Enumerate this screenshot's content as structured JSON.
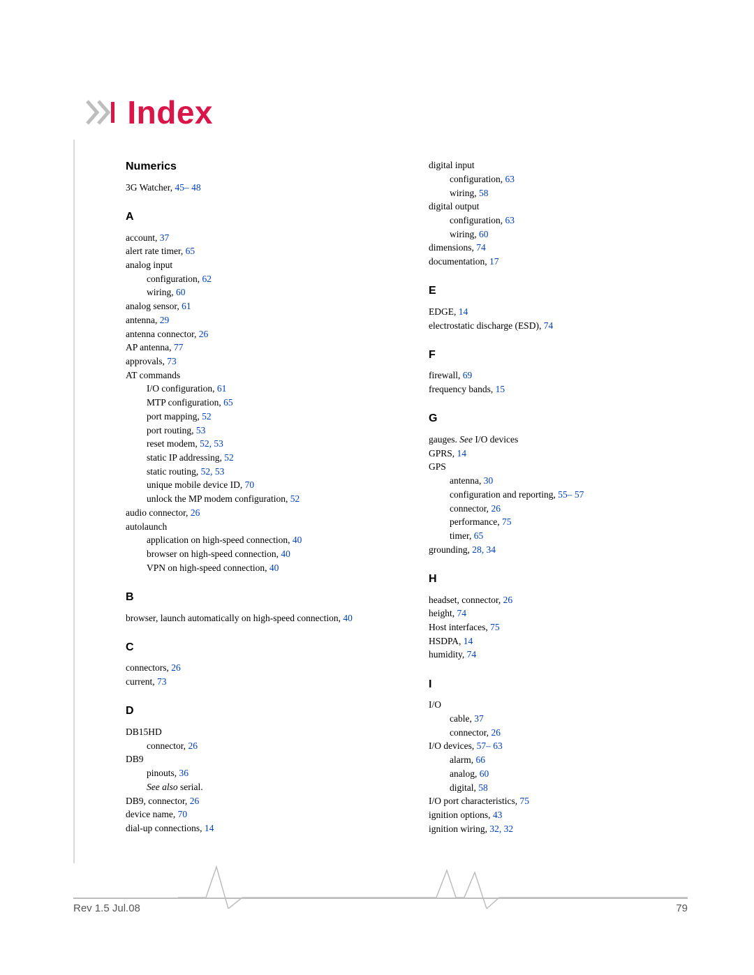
{
  "title": "Index",
  "footer": {
    "rev": "Rev 1.5  Jul.08",
    "page": "79"
  },
  "index": {
    "Numerics": {
      "ltr": "Numerics",
      "entries": [
        {
          "t": "3G Watcher,",
          "r": " 45– 48"
        }
      ]
    },
    "A": {
      "ltr": "A",
      "entries": [
        {
          "t": "account,",
          "r": " 37"
        },
        {
          "t": "alert rate timer,",
          "r": " 65"
        },
        {
          "t": "analog input"
        },
        {
          "t": "configuration,",
          "r": " 62",
          "lvl": 1
        },
        {
          "t": "wiring,",
          "r": " 60",
          "lvl": 1
        },
        {
          "t": "analog sensor,",
          "r": " 61"
        },
        {
          "t": "antenna,",
          "r": " 29"
        },
        {
          "t": "antenna connector,",
          "r": " 26"
        },
        {
          "t": "AP antenna,",
          "r": " 77"
        },
        {
          "t": "approvals,",
          "r": " 73"
        },
        {
          "t": "AT commands"
        },
        {
          "t": "I/O configuration,",
          "r": " 61",
          "lvl": 1
        },
        {
          "t": "MTP configuration,",
          "r": " 65",
          "lvl": 1
        },
        {
          "t": "port mapping,",
          "r": " 52",
          "lvl": 1
        },
        {
          "t": "port routing,",
          "r": " 53",
          "lvl": 1
        },
        {
          "t": "reset modem,",
          "r": " 52,  53",
          "lvl": 1
        },
        {
          "t": "static IP addressing,",
          "r": " 52",
          "lvl": 1
        },
        {
          "t": "static routing,",
          "r": " 52,  53",
          "lvl": 1
        },
        {
          "t": "unique mobile device ID,",
          "r": " 70",
          "lvl": 1
        },
        {
          "t": "unlock the MP modem configuration,",
          "r": " 52",
          "lvl": 1
        },
        {
          "t": "audio connector,",
          "r": " 26"
        },
        {
          "t": "autolaunch"
        },
        {
          "t": "application on high-speed connection,",
          "r": " 40",
          "lvl": 1
        },
        {
          "t": "browser on high-speed connection,",
          "r": " 40",
          "lvl": 1
        },
        {
          "t": "VPN on high-speed connection,",
          "r": " 40",
          "lvl": 1
        }
      ]
    },
    "B": {
      "ltr": "B",
      "entries": [
        {
          "html": "browser, launch automatically on high‑speed connection,",
          "r": " 40",
          "just": true
        }
      ]
    },
    "C": {
      "ltr": "C",
      "entries": [
        {
          "t": "connectors,",
          "r": " 26"
        },
        {
          "t": "current,",
          "r": " 73"
        }
      ]
    },
    "D": {
      "ltr": "D",
      "entries": [
        {
          "t": "DB15HD"
        },
        {
          "t": "connector,",
          "r": " 26",
          "lvl": 1
        },
        {
          "t": "DB9"
        },
        {
          "t": "pinouts,",
          "r": " 36",
          "lvl": 1
        },
        {
          "it": "See also",
          "t2": " serial.",
          "lvl": 1
        },
        {
          "t": "DB9, connector,",
          "r": " 26"
        },
        {
          "t": "device name,",
          "r": " 70"
        },
        {
          "t": "dial-up connections,",
          "r": " 14"
        }
      ]
    },
    "Dcol2": {
      "entries": [
        {
          "t": "digital input"
        },
        {
          "t": "configuration,",
          "r": " 63",
          "lvl": 1
        },
        {
          "t": "wiring,",
          "r": " 58",
          "lvl": 1
        },
        {
          "t": "digital output"
        },
        {
          "t": "configuration,",
          "r": " 63",
          "lvl": 1
        },
        {
          "t": "wiring,",
          "r": " 60",
          "lvl": 1
        },
        {
          "t": "dimensions,",
          "r": " 74"
        },
        {
          "t": "documentation,",
          "r": " 17"
        }
      ]
    },
    "E": {
      "ltr": "E",
      "entries": [
        {
          "t": "EDGE,",
          "r": " 14"
        },
        {
          "t": "electrostatic discharge (ESD),",
          "r": " 74"
        }
      ]
    },
    "F": {
      "ltr": "F",
      "entries": [
        {
          "t": "firewall,",
          "r": " 69"
        },
        {
          "t": "frequency bands,",
          "r": " 15"
        }
      ]
    },
    "G": {
      "ltr": "G",
      "entries": [
        {
          "t": "gauges.",
          "it2": " See ",
          "t3": "I/O devices"
        },
        {
          "t": "GPRS,",
          "r": " 14"
        },
        {
          "t": "GPS"
        },
        {
          "t": "antenna,",
          "r": " 30",
          "lvl": 1
        },
        {
          "t": "configuration and reporting,",
          "r": " 55– 57",
          "lvl": 1
        },
        {
          "t": "connector,",
          "r": " 26",
          "lvl": 1
        },
        {
          "t": "performance,",
          "r": " 75",
          "lvl": 1
        },
        {
          "t": "timer,",
          "r": " 65",
          "lvl": 1
        },
        {
          "t": "grounding,",
          "r": " 28,  34"
        }
      ]
    },
    "H": {
      "ltr": "H",
      "entries": [
        {
          "t": "headset, connector,",
          "r": " 26"
        },
        {
          "t": "height,",
          "r": " 74"
        },
        {
          "t": "Host interfaces,",
          "r": " 75"
        },
        {
          "t": "HSDPA,",
          "r": " 14"
        },
        {
          "t": "humidity,",
          "r": " 74"
        }
      ]
    },
    "I": {
      "ltr": "I",
      "entries": [
        {
          "t": "I/O"
        },
        {
          "t": "cable,",
          "r": " 37",
          "lvl": 1
        },
        {
          "t": "connector,",
          "r": " 26",
          "lvl": 1
        },
        {
          "t": "I/O devices,",
          "r": " 57– 63"
        },
        {
          "t": "alarm,",
          "r": " 66",
          "lvl": 1
        },
        {
          "t": "analog,",
          "r": " 60",
          "lvl": 1
        },
        {
          "t": "digital,",
          "r": " 58",
          "lvl": 1
        },
        {
          "t": "I/O port characteristics,",
          "r": " 75"
        },
        {
          "t": "ignition options,",
          "r": " 43"
        },
        {
          "t": "ignition wiring,",
          "r": " 32,  32"
        }
      ]
    }
  }
}
